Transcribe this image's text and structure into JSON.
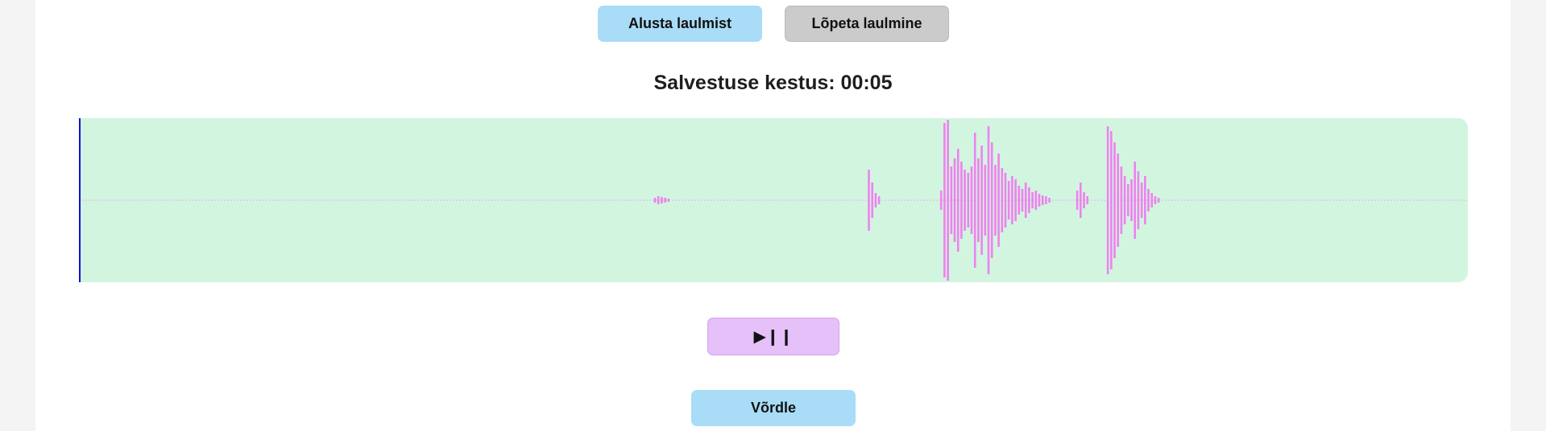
{
  "controls": {
    "start_label": "Alusta laulmist",
    "stop_label": "Lõpeta laulmine"
  },
  "recording": {
    "duration_label": "Salvestuse kestus: 00:05"
  },
  "waveform": {
    "wave_color": "#ee82ee",
    "background_color": "#d2f5e0",
    "cursor_color": "#1010d8",
    "bursts": [
      {
        "start": 0.414,
        "amps": [
          0.03,
          0.05,
          0.04,
          0.03,
          0.02
        ]
      },
      {
        "start": 0.568,
        "amps": [
          0.38,
          0.22,
          0.09,
          0.05
        ]
      },
      {
        "start": 0.62,
        "amps": [
          0.12,
          0.96,
          1.0,
          0.42,
          0.52,
          0.64,
          0.48,
          0.38,
          0.34,
          0.42,
          0.84,
          0.52,
          0.68,
          0.44,
          0.92,
          0.72,
          0.44,
          0.58,
          0.4,
          0.34,
          0.24,
          0.3,
          0.26,
          0.18,
          0.14,
          0.22,
          0.16,
          0.1,
          0.12,
          0.08,
          0.06,
          0.05,
          0.03
        ]
      },
      {
        "start": 0.718,
        "amps": [
          0.12,
          0.22,
          0.1,
          0.05
        ]
      },
      {
        "start": 0.74,
        "amps": [
          0.92,
          0.86,
          0.72,
          0.58,
          0.42,
          0.3,
          0.2,
          0.26,
          0.48,
          0.36,
          0.22,
          0.3,
          0.14,
          0.09,
          0.05,
          0.03
        ]
      }
    ]
  },
  "player": {
    "play_pause_label": "▶❙❙"
  },
  "actions": {
    "compare_label": "Võrdle"
  }
}
